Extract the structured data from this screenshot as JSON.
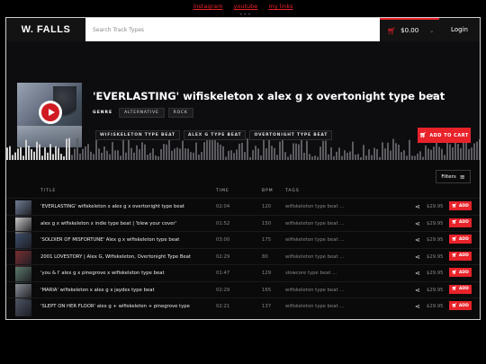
{
  "top_links": [
    "instagram",
    "youtube",
    "my links"
  ],
  "header": {
    "brand": "W. FALLS",
    "search_placeholder": "Search Track Types",
    "cart_total": "$0.00",
    "login_label": "Login"
  },
  "hero": {
    "title": "'EVERLASTING' wifiskeleton x alex g x overtonight type beat",
    "genre_label": "GENRE",
    "genres": [
      "ALTERNATIVE",
      "ROCK"
    ],
    "tags": [
      "WIFISKELETON TYPE BEAT",
      "ALEX G TYPE BEAT",
      "OVERTONIGHT TYPE BEAT"
    ],
    "add_to_cart_label": "ADD TO CART"
  },
  "list": {
    "filters_label": "Filters",
    "columns": {
      "title": "TITLE",
      "time": "TIME",
      "bpm": "BPM",
      "tags": "TAGS"
    },
    "add_label": "ADD",
    "tracks": [
      {
        "title": "'EVERLASTING' wifiskeleton x alex g x overtonight type beat",
        "time": "02:04",
        "bpm": "120",
        "tags": "wifiskeleton type beat ...",
        "price": "$29.95",
        "thumb_color": "#6f7c92"
      },
      {
        "title": "alex g x wifiskeleton x indie type beat | 'blew your cover'",
        "time": "01:52",
        "bpm": "150",
        "tags": "wifiskeleton type beat ...",
        "price": "$29.95",
        "thumb_color": "#c7c7c7"
      },
      {
        "title": "'SOLDIER OF MISFORTUNE' Alex g x wifiskeleton type beat",
        "time": "03:00",
        "bpm": "175",
        "tags": "wifiskeleton type beat ...",
        "price": "$29.95",
        "thumb_color": "#3d4e6b"
      },
      {
        "title": "2001 LOVESTORY | Alex G, Wifiskeleton, Overtonight Type Beat",
        "time": "02:29",
        "bpm": "80",
        "tags": "wifiskeleton type beat ...",
        "price": "$29.95",
        "thumb_color": "#7a2f33"
      },
      {
        "title": "'you & I' alex g x pinegrove x wifiskeleton type beat",
        "time": "01:47",
        "bpm": "129",
        "tags": "slowcore type beat ...",
        "price": "$29.95",
        "thumb_color": "#5d7a6a"
      },
      {
        "title": "'MARIA' wifiskeleton x alex g x jaydes type beat",
        "time": "02:29",
        "bpm": "165",
        "tags": "wifiskeleton type beat ...",
        "price": "$29.95",
        "thumb_color": "#8a8f96"
      },
      {
        "title": "'SLEPT ON HER FLOOR' alex g + wifiskeleton + pinegrove type",
        "time": "02:21",
        "bpm": "137",
        "tags": "wifiskeleton type beat ...",
        "price": "$29.95",
        "thumb_color": "#4b5364"
      }
    ]
  },
  "colors": {
    "accent": "#e8232a",
    "background": "#0c0c0c"
  }
}
